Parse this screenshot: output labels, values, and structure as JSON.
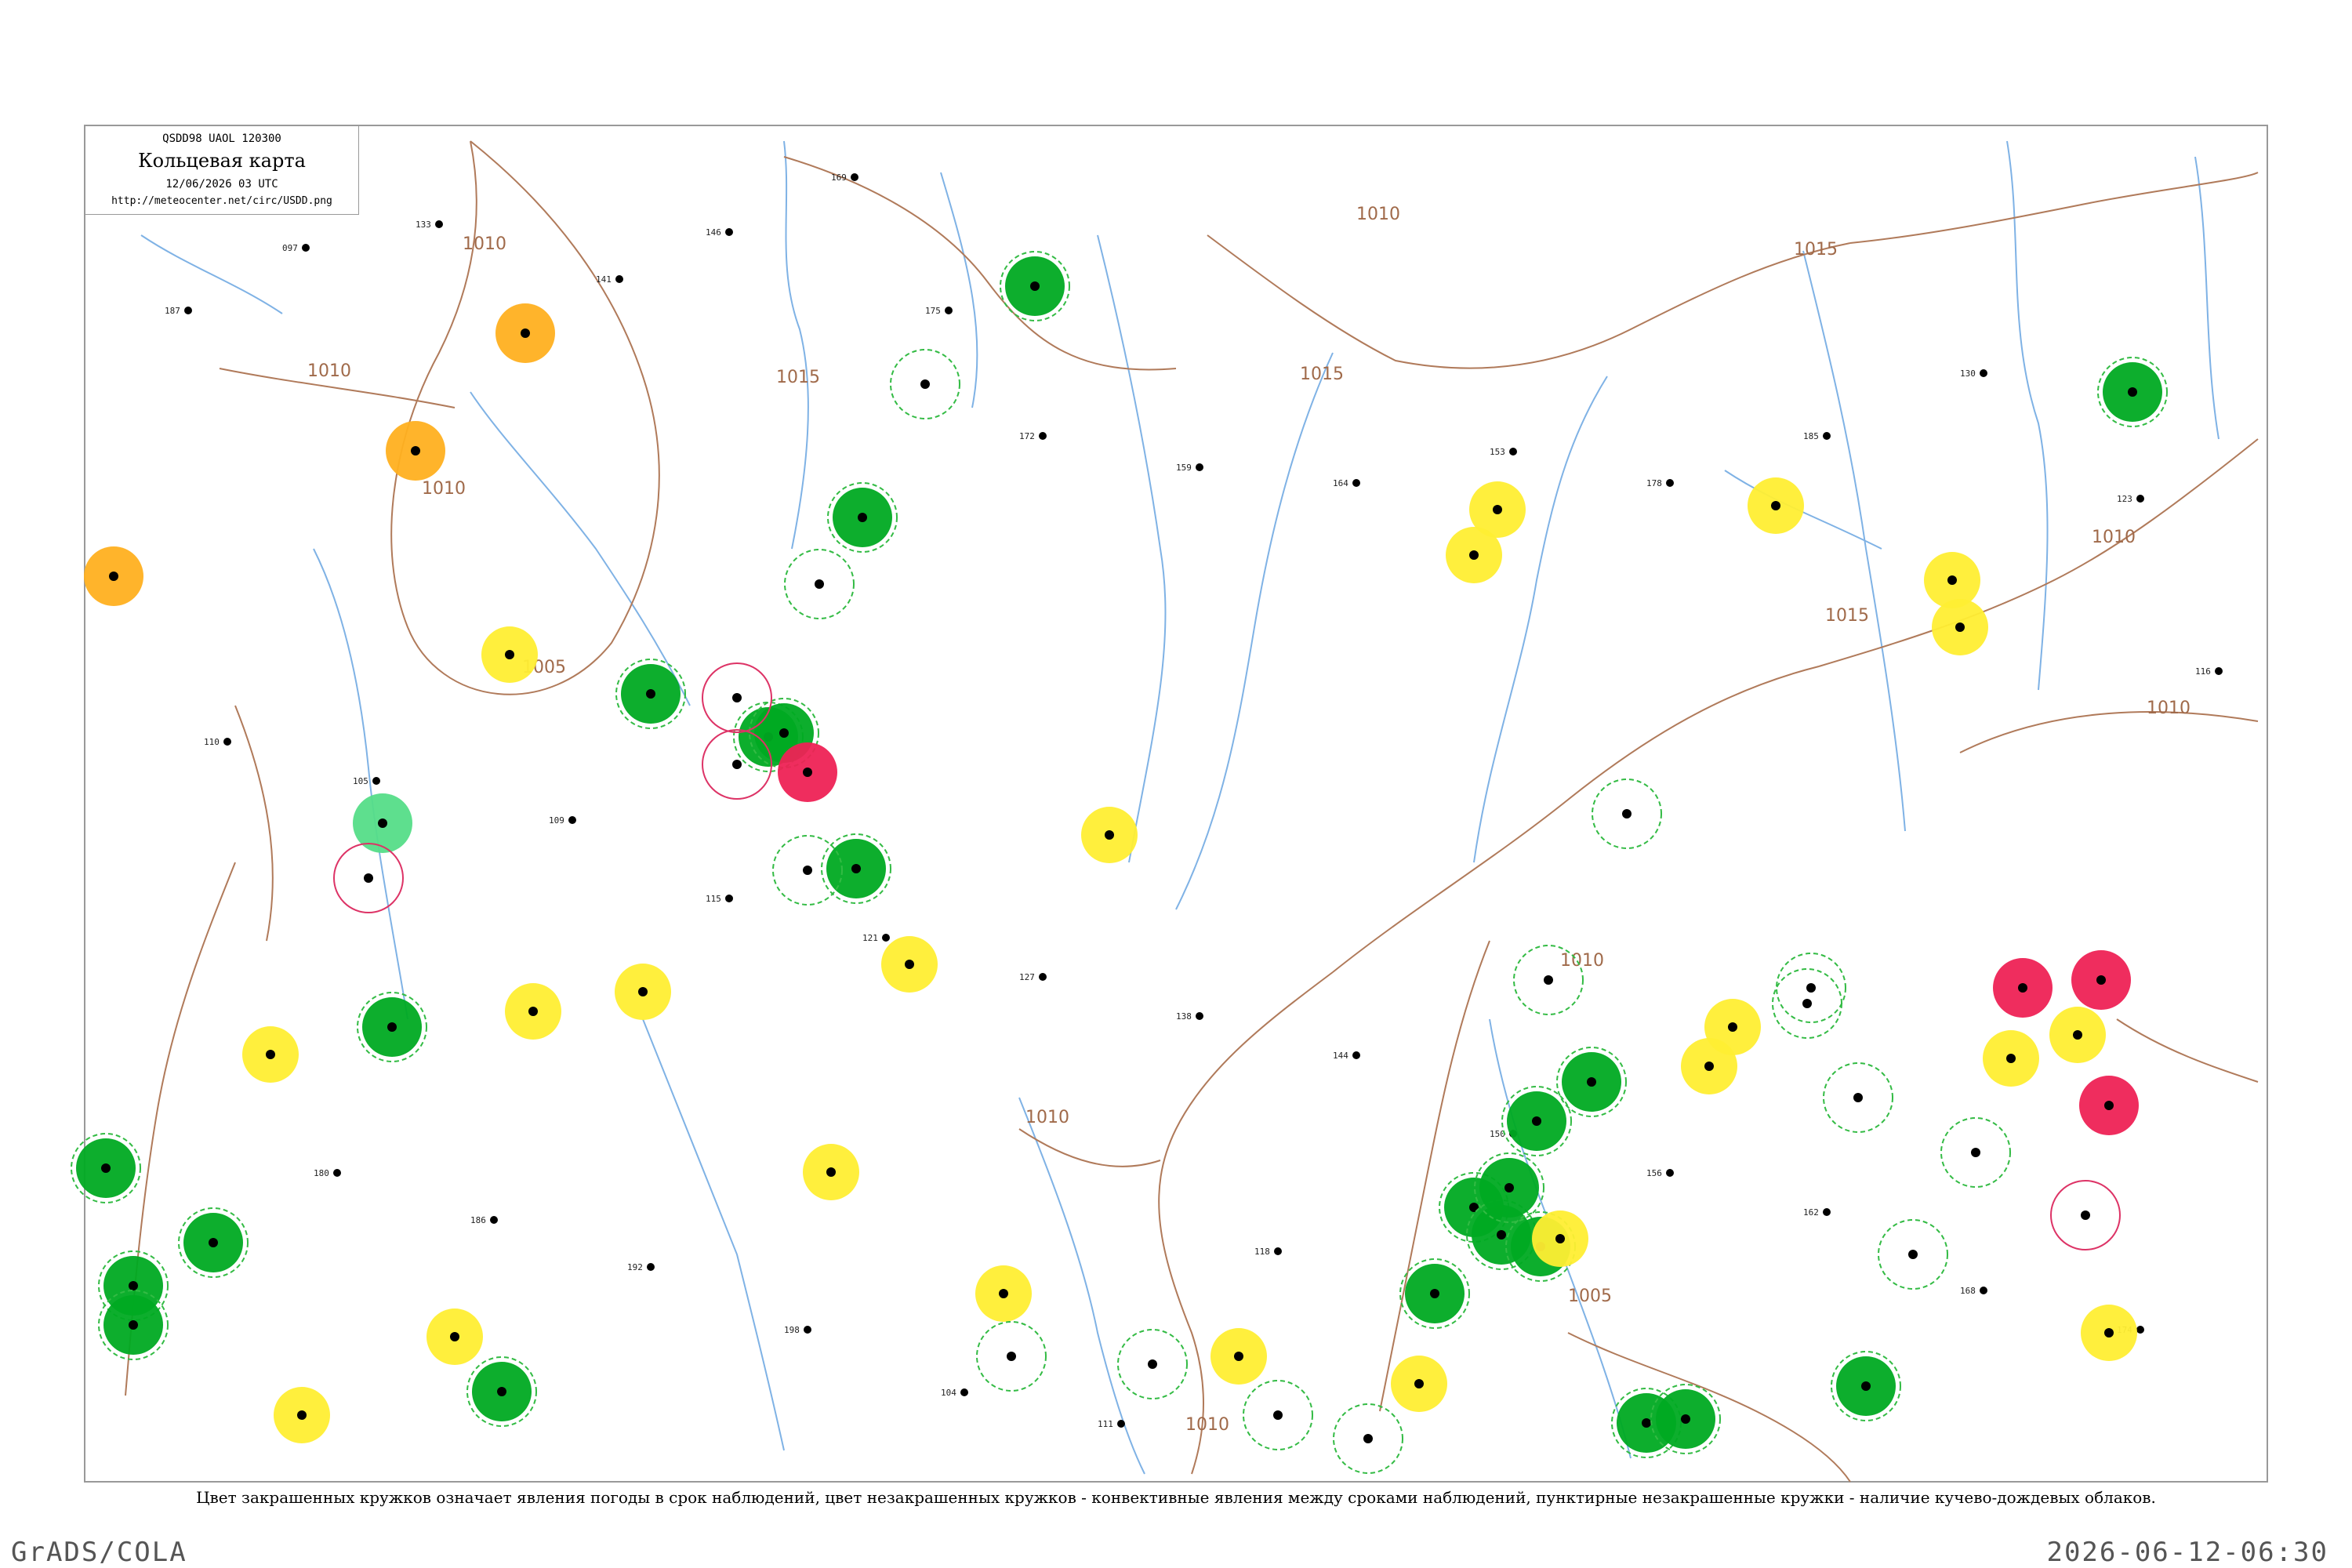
{
  "header": {
    "code": "QSDD98  UAOL  120300",
    "title": "Кольцевая карта",
    "date": "12/06/2026 03 UTC",
    "url": "http://meteocenter.net/circ/USDD.png"
  },
  "caption": "Цвет закрашенных кружков означает явления погоды в срок наблюдений, цвет незакрашенных кружков - конвективные явления между сроками наблюдений, пунктирные незакрашенные кружки - наличие кучево-дождевых облаков.",
  "footer": {
    "left": "GrADS/COLA",
    "right": "2026-06-12-06:30"
  },
  "colors": {
    "background": "#ffffff",
    "frame": "#999999",
    "isobar": "#b07a5a",
    "river": "#7fb2e5",
    "station_marker": "#000000",
    "thunderstorm": "#00aa22",
    "rain_shower": "#ffee33",
    "rain_moderate": "#ffb020",
    "heavy_precip": "#ee2255",
    "drizzle": "#55dd88",
    "cb_cloud_ring": "#33bb44",
    "convective_ring": "#dd3366"
  },
  "isobar_labels": [
    {
      "id": "i1",
      "text": "1010"
    },
    {
      "id": "i2",
      "text": "1010"
    },
    {
      "id": "i3",
      "text": "1010"
    },
    {
      "id": "i4",
      "text": "1015"
    },
    {
      "id": "i5",
      "text": "1015"
    },
    {
      "id": "i6",
      "text": "1015"
    },
    {
      "id": "i7",
      "text": "1015"
    },
    {
      "id": "i8",
      "text": "1010"
    },
    {
      "id": "i9",
      "text": "1010"
    },
    {
      "id": "i10",
      "text": "1005"
    },
    {
      "id": "i11",
      "text": "1010"
    },
    {
      "id": "i12",
      "text": "1010"
    },
    {
      "id": "i13",
      "text": "1005"
    },
    {
      "id": "i14",
      "text": "1010"
    },
    {
      "id": "i15",
      "text": "1010"
    }
  ],
  "weather_markers": [
    {
      "id": "w1",
      "type": "thunderstorm",
      "ring": "cb"
    },
    {
      "id": "w2",
      "type": "thunderstorm",
      "ring": "cb"
    },
    {
      "id": "w3",
      "type": "thunderstorm",
      "ring": "cb"
    },
    {
      "id": "w4",
      "type": "thunderstorm",
      "ring": "cb"
    },
    {
      "id": "w5",
      "type": "thunderstorm",
      "ring": "cb"
    },
    {
      "id": "w6",
      "type": "thunderstorm",
      "ring": "cb"
    },
    {
      "id": "w7",
      "type": "thunderstorm",
      "ring": "cb"
    },
    {
      "id": "w8",
      "type": "thunderstorm",
      "ring": "cb"
    },
    {
      "id": "w9",
      "type": "thunderstorm",
      "ring": "cb"
    },
    {
      "id": "w10",
      "type": "thunderstorm",
      "ring": "cb"
    },
    {
      "id": "w11",
      "type": "thunderstorm",
      "ring": "cb"
    },
    {
      "id": "w12",
      "type": "thunderstorm",
      "ring": "cb"
    },
    {
      "id": "w13",
      "type": "thunderstorm",
      "ring": "cb"
    },
    {
      "id": "w14",
      "type": "thunderstorm",
      "ring": "cb"
    },
    {
      "id": "w15",
      "type": "thunderstorm",
      "ring": "cb"
    },
    {
      "id": "w16",
      "type": "thunderstorm",
      "ring": "cb"
    },
    {
      "id": "w17",
      "type": "thunderstorm",
      "ring": "cb"
    },
    {
      "id": "w18",
      "type": "thunderstorm",
      "ring": "cb"
    },
    {
      "id": "w19",
      "type": "thunderstorm",
      "ring": "cb"
    },
    {
      "id": "w20",
      "type": "thunderstorm",
      "ring": "cb"
    },
    {
      "id": "w21",
      "type": "thunderstorm",
      "ring": "cb"
    },
    {
      "id": "w22",
      "type": "thunderstorm",
      "ring": "cb"
    },
    {
      "id": "w23",
      "type": "thunderstorm",
      "ring": "cb"
    },
    {
      "id": "w24",
      "type": "heavy_precip",
      "ring": "none"
    },
    {
      "id": "w25",
      "type": "heavy_precip",
      "ring": "none"
    },
    {
      "id": "w26",
      "type": "heavy_precip",
      "ring": "none"
    },
    {
      "id": "w27",
      "type": "heavy_precip",
      "ring": "none"
    },
    {
      "id": "w28",
      "type": "rain_moderate",
      "ring": "none"
    },
    {
      "id": "w29",
      "type": "rain_moderate",
      "ring": "none"
    },
    {
      "id": "w30",
      "type": "rain_moderate",
      "ring": "none"
    },
    {
      "id": "w31",
      "type": "drizzle",
      "ring": "none"
    },
    {
      "id": "w32",
      "type": "rain_shower",
      "ring": "none"
    },
    {
      "id": "w33",
      "type": "rain_shower",
      "ring": "none"
    },
    {
      "id": "w34",
      "type": "rain_shower",
      "ring": "none"
    },
    {
      "id": "w35",
      "type": "rain_shower",
      "ring": "none"
    },
    {
      "id": "w36",
      "type": "rain_shower",
      "ring": "none"
    },
    {
      "id": "w37",
      "type": "rain_shower",
      "ring": "none"
    },
    {
      "id": "w38",
      "type": "rain_shower",
      "ring": "none"
    },
    {
      "id": "w39",
      "type": "rain_shower",
      "ring": "none"
    },
    {
      "id": "w40",
      "type": "rain_shower",
      "ring": "none"
    },
    {
      "id": "w41",
      "type": "rain_shower",
      "ring": "none"
    },
    {
      "id": "w42",
      "type": "rain_shower",
      "ring": "none"
    },
    {
      "id": "w43",
      "type": "rain_shower",
      "ring": "none"
    },
    {
      "id": "w44",
      "type": "rain_shower",
      "ring": "none"
    },
    {
      "id": "w45",
      "type": "rain_shower",
      "ring": "none"
    },
    {
      "id": "w46",
      "type": "rain_shower",
      "ring": "none"
    },
    {
      "id": "w47",
      "type": "rain_shower",
      "ring": "none"
    },
    {
      "id": "w48",
      "type": "rain_shower",
      "ring": "none"
    },
    {
      "id": "w49",
      "type": "rain_shower",
      "ring": "none"
    },
    {
      "id": "w50",
      "type": "rain_shower",
      "ring": "none"
    },
    {
      "id": "w51",
      "type": "rain_shower",
      "ring": "none"
    },
    {
      "id": "w52",
      "type": "rain_shower",
      "ring": "none"
    },
    {
      "id": "w53",
      "type": "rain_shower",
      "ring": "none"
    },
    {
      "id": "w54",
      "type": "rain_shower",
      "ring": "none"
    },
    {
      "id": "w55",
      "type": "rain_shower",
      "ring": "none"
    },
    {
      "id": "w56",
      "type": "cb_only",
      "ring": "cb"
    },
    {
      "id": "w57",
      "type": "cb_only",
      "ring": "cb"
    },
    {
      "id": "w58",
      "type": "cb_only",
      "ring": "cb"
    },
    {
      "id": "w59",
      "type": "cb_only",
      "ring": "cb"
    },
    {
      "id": "w60",
      "type": "cb_only",
      "ring": "cb"
    },
    {
      "id": "w61",
      "type": "cb_only",
      "ring": "cb"
    },
    {
      "id": "w62",
      "type": "cb_only",
      "ring": "cb"
    },
    {
      "id": "w63",
      "type": "cb_only",
      "ring": "cb"
    },
    {
      "id": "w64",
      "type": "cb_only",
      "ring": "cb"
    },
    {
      "id": "w65",
      "type": "cb_only",
      "ring": "cb"
    },
    {
      "id": "w66",
      "type": "cb_only",
      "ring": "cb"
    },
    {
      "id": "w67",
      "type": "cb_only",
      "ring": "cb"
    },
    {
      "id": "w68",
      "type": "cb_only",
      "ring": "cb"
    },
    {
      "id": "w69",
      "type": "cb_only",
      "ring": "cb"
    },
    {
      "id": "w70",
      "type": "convective",
      "ring": "conv"
    },
    {
      "id": "w71",
      "type": "convective",
      "ring": "conv"
    },
    {
      "id": "w72",
      "type": "convective",
      "ring": "conv"
    },
    {
      "id": "w73",
      "type": "convective",
      "ring": "conv"
    }
  ],
  "station_labels": [
    {
      "id": "s1",
      "t": "187"
    },
    {
      "id": "s2",
      "t": "097"
    },
    {
      "id": "s3",
      "t": "133"
    },
    {
      "id": "s4",
      "t": "141"
    },
    {
      "id": "s5",
      "t": "146"
    },
    {
      "id": "s6",
      "t": "169"
    },
    {
      "id": "s7",
      "t": "175"
    },
    {
      "id": "s8",
      "t": "172"
    },
    {
      "id": "s9",
      "t": "159"
    },
    {
      "id": "s10",
      "t": "164"
    },
    {
      "id": "s11",
      "t": "153"
    },
    {
      "id": "s12",
      "t": "178"
    },
    {
      "id": "s13",
      "t": "185"
    },
    {
      "id": "s14",
      "t": "130"
    },
    {
      "id": "s15",
      "t": "123"
    },
    {
      "id": "s16",
      "t": "116"
    },
    {
      "id": "s17",
      "t": "110"
    },
    {
      "id": "s18",
      "t": "105"
    },
    {
      "id": "s19",
      "t": "109"
    },
    {
      "id": "s20",
      "t": "115"
    },
    {
      "id": "s21",
      "t": "121"
    },
    {
      "id": "s22",
      "t": "127"
    },
    {
      "id": "s23",
      "t": "138"
    },
    {
      "id": "s24",
      "t": "144"
    },
    {
      "id": "s25",
      "t": "150"
    },
    {
      "id": "s26",
      "t": "156"
    },
    {
      "id": "s27",
      "t": "162"
    },
    {
      "id": "s28",
      "t": "168"
    },
    {
      "id": "s29",
      "t": "174"
    },
    {
      "id": "s30",
      "t": "180"
    },
    {
      "id": "s31",
      "t": "186"
    },
    {
      "id": "s32",
      "t": "192"
    },
    {
      "id": "s33",
      "t": "198"
    },
    {
      "id": "s34",
      "t": "104"
    },
    {
      "id": "s35",
      "t": "111"
    },
    {
      "id": "s36",
      "t": "118"
    }
  ]
}
